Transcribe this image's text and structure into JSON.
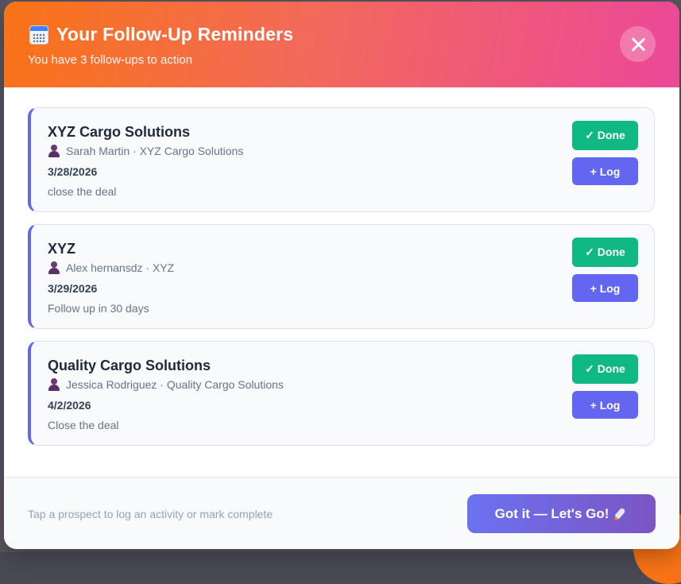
{
  "header": {
    "icon": "calendar-icon",
    "title": "Your Follow-Up Reminders",
    "subtitle": "You have 3 follow-ups to action",
    "close_icon": "close-icon"
  },
  "reminders": [
    {
      "company": "XYZ Cargo Solutions",
      "contact": "Sarah Martin · XYZ Cargo Solutions",
      "date": "3/28/2026",
      "note": "close the deal",
      "done_label": "✓ Done",
      "log_label": "+ Log"
    },
    {
      "company": "XYZ",
      "contact": "Alex hernansdz · XYZ",
      "date": "3/29/2026",
      "note": "Follow up in 30 days",
      "done_label": "✓ Done",
      "log_label": "+ Log"
    },
    {
      "company": "Quality Cargo Solutions",
      "contact": "Jessica Rodriguez · Quality Cargo Solutions",
      "date": "4/2/2026",
      "note": "Close the deal",
      "done_label": "✓ Done",
      "log_label": "+ Log"
    }
  ],
  "footer": {
    "hint": "Tap a prospect to log an activity or mark complete",
    "cta_label": "Got it — Let's Go!",
    "cta_icon": "rocket-icon"
  },
  "colors": {
    "header_gradient_start": "#f97316",
    "header_gradient_end": "#ec4899",
    "done": "#10b981",
    "log": "#6366f1",
    "card_accent": "#6366f1"
  }
}
